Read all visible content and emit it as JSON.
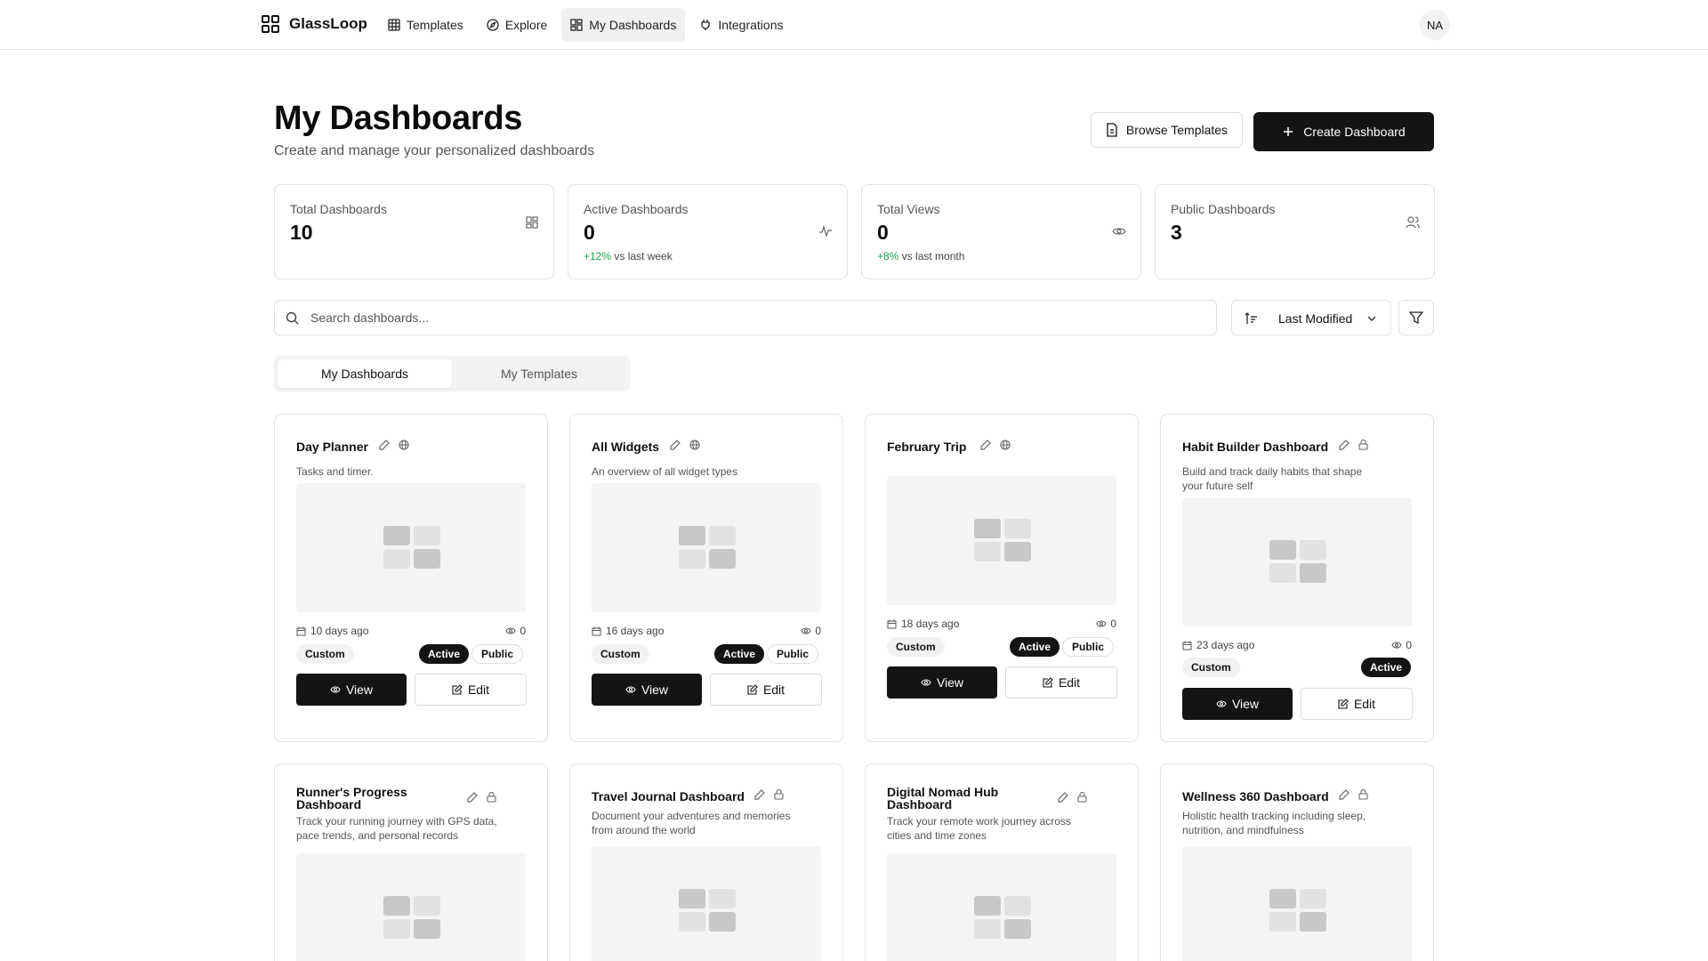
{
  "nav": {
    "brand": "GlassLoop",
    "items": [
      {
        "label": "Templates",
        "icon": "grid-icon"
      },
      {
        "label": "Explore",
        "icon": "compass-icon"
      },
      {
        "label": "My Dashboards",
        "icon": "dashboard-icon",
        "active": true
      },
      {
        "label": "Integrations",
        "icon": "plug-icon"
      }
    ],
    "avatar_initials": "NA"
  },
  "header": {
    "title": "My Dashboards",
    "subtitle": "Create and manage your personalized dashboards",
    "browse_label": "Browse Templates",
    "create_label": "Create Dashboard"
  },
  "stats": [
    {
      "label": "Total Dashboards",
      "value": "10",
      "change": "",
      "change_suffix": "",
      "icon": "dashboard-icon"
    },
    {
      "label": "Active Dashboards",
      "value": "0",
      "change": "+12%",
      "change_suffix": " vs last week",
      "icon": "activity-icon"
    },
    {
      "label": "Total Views",
      "value": "0",
      "change": "+8%",
      "change_suffix": " vs last month",
      "icon": "eye-icon"
    },
    {
      "label": "Public Dashboards",
      "value": "3",
      "change": "",
      "change_suffix": "",
      "icon": "users-icon"
    }
  ],
  "search": {
    "placeholder": "Search dashboards..."
  },
  "sort": {
    "selected": "Last Modified"
  },
  "tabs": [
    {
      "label": "My Dashboards",
      "active": true
    },
    {
      "label": "My Templates",
      "active": false
    }
  ],
  "cards": [
    {
      "title": "Day Planner",
      "description": "Tasks and timer.",
      "visibility_icon": "globe-icon",
      "date": "10 days ago",
      "views": "0",
      "type": "Custom",
      "status": "Active",
      "visibility": "Public",
      "view_label": "View",
      "edit_label": "Edit"
    },
    {
      "title": "All Widgets",
      "description": "An overview of all widget types",
      "visibility_icon": "globe-icon",
      "date": "16 days ago",
      "views": "0",
      "type": "Custom",
      "status": "Active",
      "visibility": "Public",
      "view_label": "View",
      "edit_label": "Edit"
    },
    {
      "title": "February Trip",
      "description": "",
      "visibility_icon": "globe-icon",
      "date": "18 days ago",
      "views": "0",
      "type": "Custom",
      "status": "Active",
      "visibility": "Public",
      "view_label": "View",
      "edit_label": "Edit"
    },
    {
      "title": "Habit Builder Dashboard",
      "description": "Build and track daily habits that shape your future self",
      "visibility_icon": "lock-icon",
      "date": "23 days ago",
      "views": "0",
      "type": "Custom",
      "status": "Active",
      "visibility": "",
      "view_label": "View",
      "edit_label": "Edit"
    },
    {
      "title": "Runner's Progress Dashboard",
      "description": "Track your running journey with GPS data, pace trends, and personal records",
      "visibility_icon": "lock-icon"
    },
    {
      "title": "Travel Journal Dashboard",
      "description": "Document your adventures and memories from around the world",
      "visibility_icon": "lock-icon"
    },
    {
      "title": "Digital Nomad Hub Dashboard",
      "description": "Track your remote work journey across cities and time zones",
      "visibility_icon": "lock-icon"
    },
    {
      "title": "Wellness 360 Dashboard",
      "description": "Holistic health tracking including sleep, nutrition, and mindfulness",
      "visibility_icon": "lock-icon"
    }
  ],
  "colors": {
    "accent": "#141414",
    "positive": "#16a34a",
    "preview_bg": "#f4f4f4",
    "tile_dark": "#c8c8c8",
    "tile_light": "#e2e2e2"
  }
}
